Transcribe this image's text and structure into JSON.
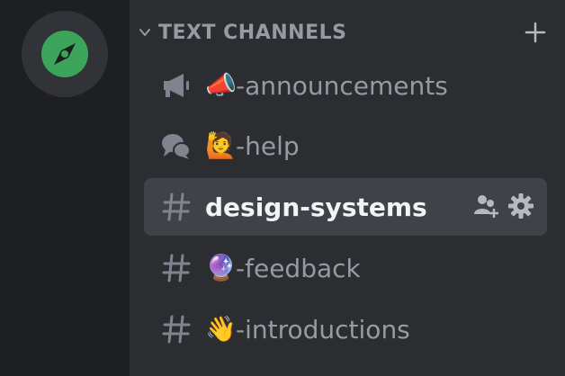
{
  "colors": {
    "rail_bg": "#1e1f22",
    "list_bg": "#2b2d31",
    "selected_bg": "#404249",
    "muted_text": "#949ba4",
    "active_text": "#f2f3f5",
    "server_accent": "#3ba55c"
  },
  "server": {
    "icon": "compass-icon"
  },
  "category": {
    "label": "TEXT CHANNELS",
    "chevron_icon": "chevron-down-icon",
    "add_icon": "plus-icon"
  },
  "channels": [
    {
      "icon": "megaphone-icon",
      "emoji": "📣",
      "name": "-announcements",
      "selected": false
    },
    {
      "icon": "speech-bubbles-icon",
      "emoji": "🙋",
      "name": "-help",
      "selected": false
    },
    {
      "icon": "hash-icon",
      "emoji": "",
      "name": "design-systems",
      "selected": true,
      "actions": [
        "add-member-icon",
        "gear-icon"
      ]
    },
    {
      "icon": "hash-icon",
      "emoji": "🔮",
      "name": "-feedback",
      "selected": false
    },
    {
      "icon": "hash-icon",
      "emoji": "👋",
      "name": "-introductions",
      "selected": false
    }
  ]
}
